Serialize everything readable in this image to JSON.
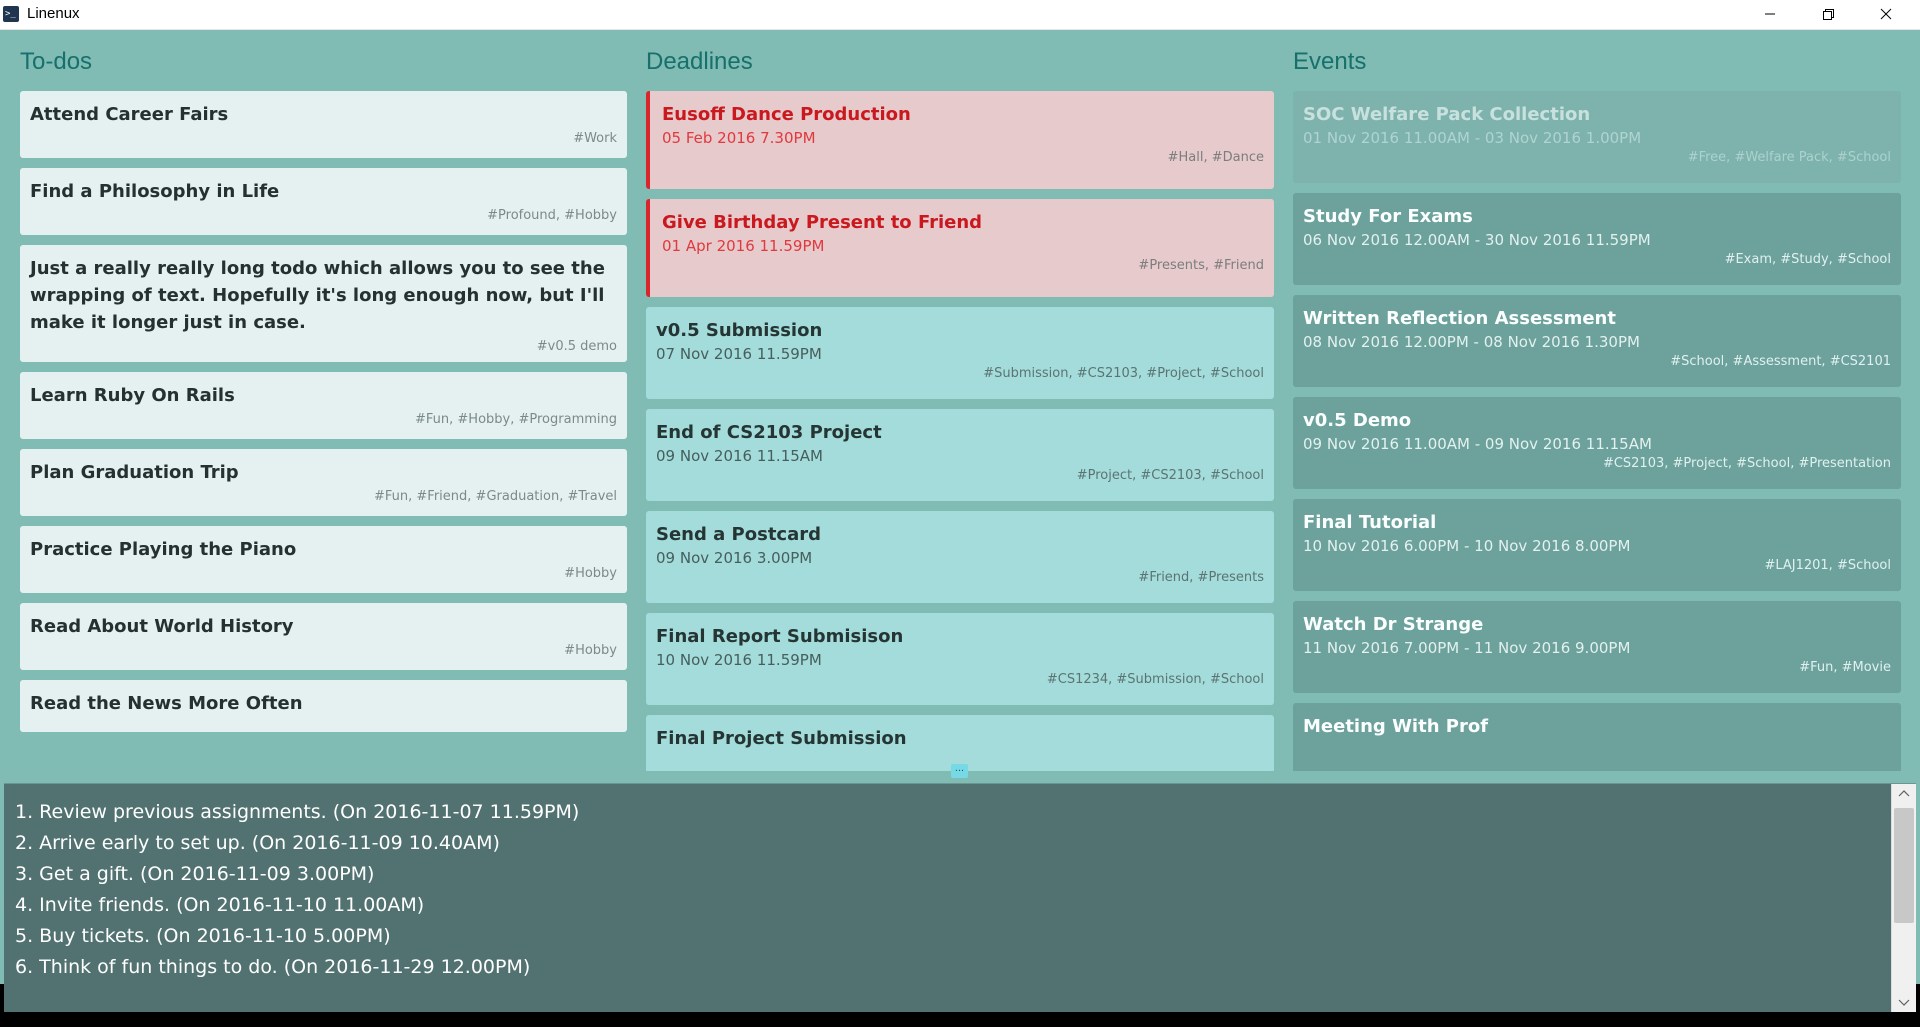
{
  "window": {
    "title": "Linenux",
    "app_icon": "terminal-icon",
    "controls": [
      "minimize-icon",
      "maximize-icon",
      "close-icon"
    ]
  },
  "columns": {
    "todos_title": "To-dos",
    "deadlines_title": "Deadlines",
    "events_title": "Events"
  },
  "todos": [
    {
      "name": "Attend Career Fairs",
      "tags": "#Work"
    },
    {
      "name": "Find a Philosophy in Life",
      "tags": "#Profound, #Hobby"
    },
    {
      "name": "Just a really really long todo which allows you to see the wrapping of text. Hopefully it's long enough now, but I'll make it longer just in case.",
      "tags": "#v0.5 demo"
    },
    {
      "name": "Learn Ruby On Rails",
      "tags": "#Fun, #Hobby, #Programming"
    },
    {
      "name": "Plan Graduation Trip",
      "tags": "#Fun, #Friend, #Graduation, #Travel"
    },
    {
      "name": "Practice Playing the Piano",
      "tags": "#Hobby"
    },
    {
      "name": "Read About World History",
      "tags": "#Hobby"
    },
    {
      "name": "Read the News More Often",
      "tags": ""
    }
  ],
  "deadlines": [
    {
      "name": "Eusoff Dance Production",
      "date": "05 Feb 2016 7.30PM",
      "tags": "#Hall, #Dance",
      "overdue": true
    },
    {
      "name": "Give Birthday Present to Friend",
      "date": "01 Apr 2016 11.59PM",
      "tags": "#Presents, #Friend",
      "overdue": true
    },
    {
      "name": "v0.5 Submission",
      "date": "07 Nov 2016 11.59PM",
      "tags": "#Submission, #CS2103, #Project, #School",
      "overdue": false
    },
    {
      "name": "End of CS2103 Project",
      "date": "09 Nov 2016 11.15AM",
      "tags": "#Project, #CS2103, #School",
      "overdue": false
    },
    {
      "name": "Send a Postcard",
      "date": "09 Nov 2016 3.00PM",
      "tags": "#Friend, #Presents",
      "overdue": false
    },
    {
      "name": "Final Report Submisison",
      "date": "10 Nov 2016 11.59PM",
      "tags": "#CS1234, #Submission, #School",
      "overdue": false
    },
    {
      "name": "Final Project Submission",
      "date": "",
      "tags": "",
      "overdue": false
    }
  ],
  "events": [
    {
      "name": "SOC Welfare Pack Collection",
      "date": "01 Nov 2016 11.00AM - 03 Nov 2016 1.00PM",
      "tags": "#Free, #Welfare Pack, #School",
      "past": true
    },
    {
      "name": "Study For Exams",
      "date": "06 Nov 2016 12.00AM - 30 Nov 2016 11.59PM",
      "tags": "#Exam, #Study, #School",
      "past": false
    },
    {
      "name": "Written Reflection Assessment",
      "date": "08 Nov 2016 12.00PM - 08 Nov 2016 1.30PM",
      "tags": "#School, #Assessment, #CS2101",
      "past": false
    },
    {
      "name": "v0.5 Demo",
      "date": "09 Nov 2016 11.00AM - 09 Nov 2016 11.15AM",
      "tags": "#CS2103, #Project, #School, #Presentation",
      "past": false
    },
    {
      "name": "Final Tutorial",
      "date": "10 Nov 2016 6.00PM - 10 Nov 2016 8.00PM",
      "tags": "#LAJ1201, #School",
      "past": false
    },
    {
      "name": "Watch Dr Strange",
      "date": "11 Nov 2016 7.00PM - 11 Nov 2016 9.00PM",
      "tags": "#Fun, #Movie",
      "past": false
    },
    {
      "name": "Meeting With Prof",
      "date": "",
      "tags": "",
      "past": false
    }
  ],
  "divider_handle": "...",
  "output": [
    "1. Review previous assignments. (On 2016-11-07 11.59PM)",
    "2. Arrive early to set up. (On 2016-11-09 10.40AM)",
    "3. Get a gift. (On 2016-11-09 3.00PM)",
    "4. Invite friends. (On 2016-11-10 11.00AM)",
    "5. Buy tickets. (On 2016-11-10 5.00PM)",
    "6. Think of fun things to do. (On 2016-11-29 12.00PM)"
  ],
  "colors": {
    "main_bg": "#80bbb4",
    "title": "#17706b",
    "overdue_accent": "#d9262c",
    "output_bg": "#527272"
  }
}
